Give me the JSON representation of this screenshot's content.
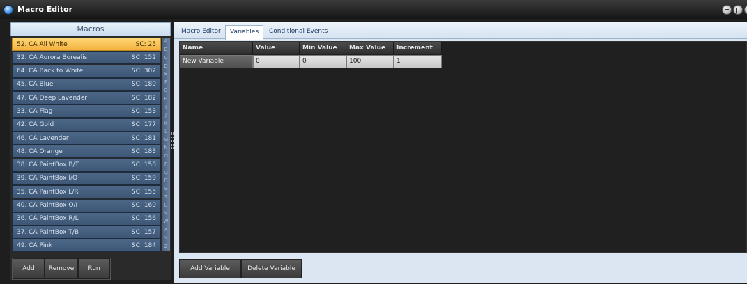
{
  "window": {
    "title": "Macro Editor"
  },
  "macros": {
    "header": "Macros",
    "items": [
      {
        "name": "52. CA All White",
        "sc": "SC: 25",
        "selected": true
      },
      {
        "name": "32. CA Aurora Borealis",
        "sc": "SC: 152"
      },
      {
        "name": "64. CA Back to White",
        "sc": "SC: 302"
      },
      {
        "name": "45. CA Blue",
        "sc": "SC: 180"
      },
      {
        "name": "47. CA Deep Lavender",
        "sc": "SC: 182"
      },
      {
        "name": "33. CA Flag",
        "sc": "SC: 153"
      },
      {
        "name": "42. CA Gold",
        "sc": "SC: 177"
      },
      {
        "name": "46. CA Lavender",
        "sc": "SC: 181"
      },
      {
        "name": "48. CA Orange",
        "sc": "SC: 183"
      },
      {
        "name": "38. CA PaintBox B/T",
        "sc": "SC: 158"
      },
      {
        "name": "39. CA PaintBox I/O",
        "sc": "SC: 159"
      },
      {
        "name": "35. CA PaintBox L/R",
        "sc": "SC: 155"
      },
      {
        "name": "40. CA PaintBox O/I",
        "sc": "SC: 160"
      },
      {
        "name": "36. CA PaintBox R/L",
        "sc": "SC: 156"
      },
      {
        "name": "37. CA PaintBox T/B",
        "sc": "SC: 157"
      },
      {
        "name": "49. CA Pink",
        "sc": "SC: 184"
      }
    ],
    "alphabet": [
      "A",
      "B",
      "C",
      "D",
      "E",
      "F",
      "G",
      "H",
      "I",
      "J",
      "K",
      "L",
      "M",
      "N",
      "O",
      "P",
      "Q",
      "R",
      "S",
      "T",
      "U",
      "V",
      "W",
      "X",
      "Y",
      "Z"
    ],
    "buttons": {
      "add": "Add",
      "remove": "Remove",
      "run": "Run"
    }
  },
  "tabs": [
    {
      "label": "Macro Editor"
    },
    {
      "label": "Variables",
      "active": true
    },
    {
      "label": "Conditional Events"
    }
  ],
  "variables": {
    "columns": [
      "Name",
      "Value",
      "Min Value",
      "Max Value",
      "Increment"
    ],
    "rows": [
      [
        "New Variable",
        "0",
        "0",
        "100",
        "1"
      ]
    ]
  },
  "buttons": {
    "add_variable": "Add Variable",
    "delete_variable": "Delete Variable"
  },
  "colors": {
    "selected": "#f3b03e",
    "accent": "#3a8de0"
  }
}
